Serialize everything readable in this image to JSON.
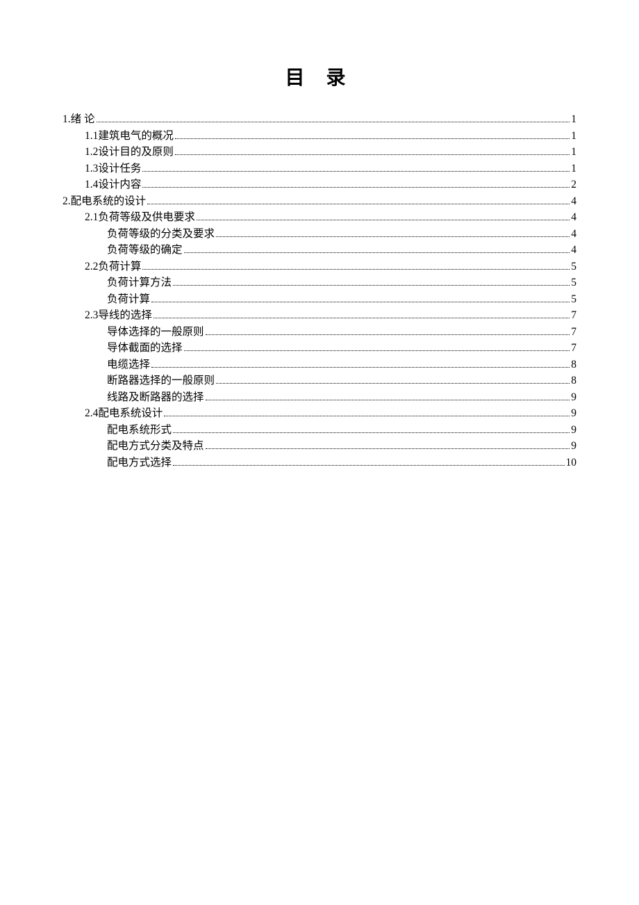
{
  "title": "目 录",
  "toc": [
    {
      "level": 0,
      "label": "1.绪 论",
      "page": "1"
    },
    {
      "level": 1,
      "label": "1.1建筑电气的概况",
      "page": "1"
    },
    {
      "level": 1,
      "label": "1.2设计目的及原则",
      "page": "1"
    },
    {
      "level": 1,
      "label": "1.3设计任务",
      "page": "1"
    },
    {
      "level": 1,
      "label": "1.4设计内容",
      "page": "2"
    },
    {
      "level": 0,
      "label": "2.配电系统的设计",
      "page": "4"
    },
    {
      "level": 1,
      "label": "2.1负荷等级及供电要求",
      "page": "4"
    },
    {
      "level": 2,
      "label": "负荷等级的分类及要求",
      "page": "4"
    },
    {
      "level": 2,
      "label": "负荷等级的确定",
      "page": "4"
    },
    {
      "level": 1,
      "label": "2.2负荷计算",
      "page": "5"
    },
    {
      "level": 2,
      "label": "负荷计算方法",
      "page": "5"
    },
    {
      "level": 2,
      "label": "负荷计算",
      "page": "5"
    },
    {
      "level": 1,
      "label": "2.3导线的选择",
      "page": "7"
    },
    {
      "level": 2,
      "label": "导体选择的一般原则",
      "page": "7"
    },
    {
      "level": 2,
      "label": "导体截面的选择",
      "page": "7"
    },
    {
      "level": 2,
      "label": "电缆选择",
      "page": "8"
    },
    {
      "level": 2,
      "label": "断路器选择的一般原则",
      "page": "8"
    },
    {
      "level": 2,
      "label": "线路及断路器的选择",
      "page": "9"
    },
    {
      "level": 1,
      "label": "2.4配电系统设计",
      "page": "9"
    },
    {
      "level": 2,
      "label": "配电系统形式",
      "page": "9"
    },
    {
      "level": 2,
      "label": "配电方式分类及特点",
      "page": "9"
    },
    {
      "level": 2,
      "label": "配电方式选择",
      "page": "10"
    }
  ]
}
